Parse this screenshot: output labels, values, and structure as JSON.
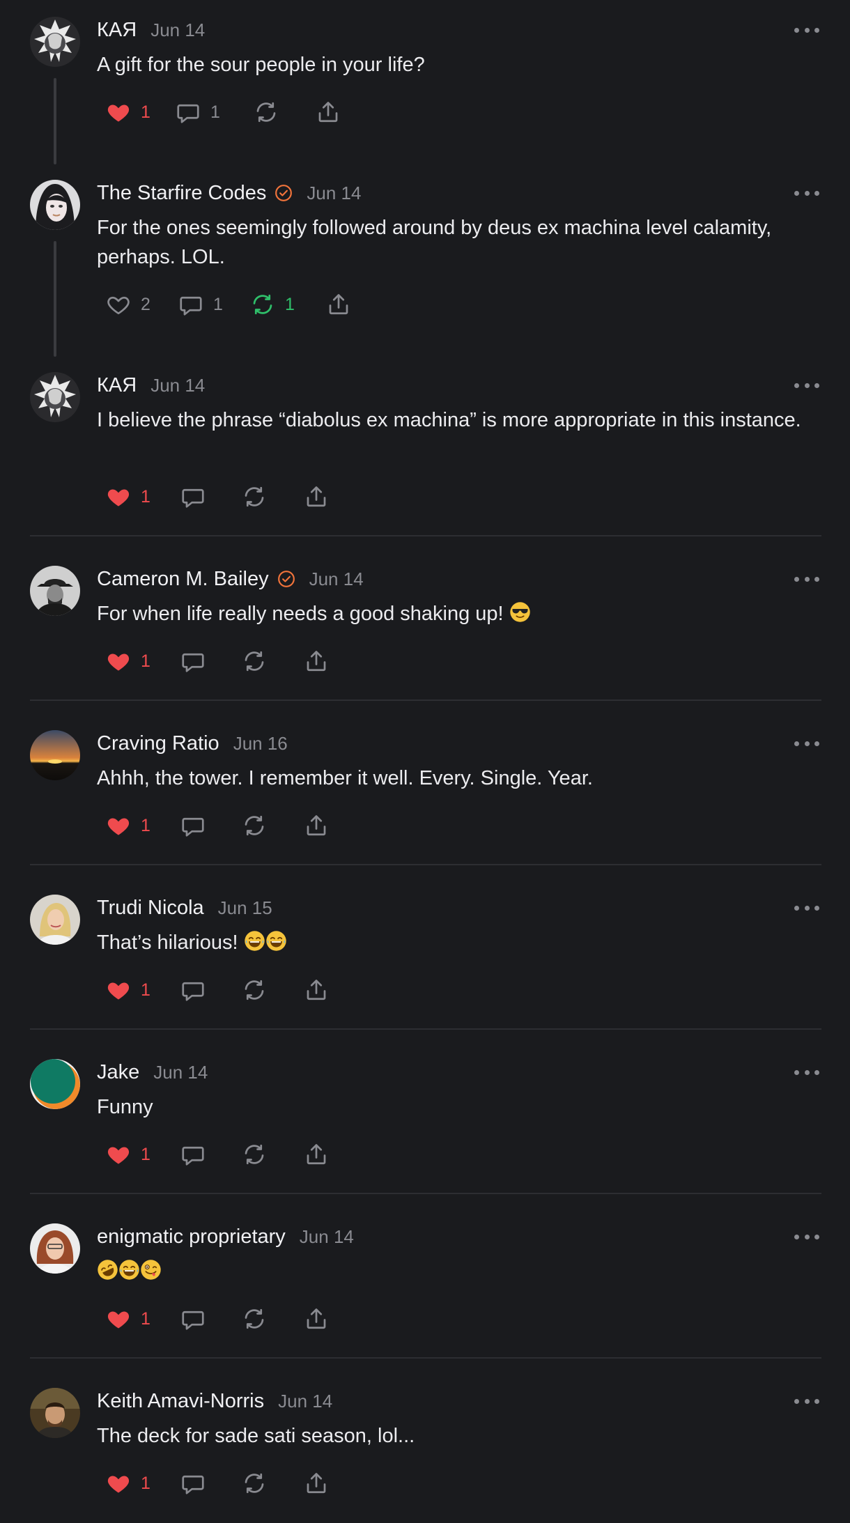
{
  "colors": {
    "background": "#1a1b1e",
    "like_active": "#ef4b4e",
    "repost_active": "#2fbf6a",
    "verified": "#f2743b",
    "muted": "#8a8b91"
  },
  "posts": [
    {
      "name": "КАЯ",
      "date": "Jun 14",
      "text": "A gift for the sour people in your life?",
      "likes": "1",
      "replies": "1",
      "reposts": ""
    },
    {
      "name": "The Starfire Codes",
      "date": "Jun 14",
      "text": "For the ones seemingly followed around by deus ex machina level calamity, perhaps. LOL.",
      "likes": "2",
      "replies": "1",
      "reposts": "1"
    },
    {
      "name": "КАЯ",
      "date": "Jun 14",
      "text": "I believe the phrase “diabolus ex machina” is more appropriate in this instance.",
      "likes": "1",
      "replies": "",
      "reposts": ""
    },
    {
      "name": "Cameron M. Bailey",
      "date": "Jun 14",
      "text": "For when life really needs a good shaking up!",
      "likes": "1",
      "replies": "",
      "reposts": ""
    },
    {
      "name": "Craving Ratio",
      "date": "Jun 16",
      "text": "Ahhh, the tower. I remember it well. Every. Single. Year.",
      "likes": "1",
      "replies": "",
      "reposts": ""
    },
    {
      "name": "Trudi Nicola",
      "date": "Jun 15",
      "text": "That’s hilarious!",
      "likes": "1",
      "replies": "",
      "reposts": ""
    },
    {
      "name": "Jake",
      "date": "Jun 14",
      "text": "Funny",
      "likes": "1",
      "replies": "",
      "reposts": ""
    },
    {
      "name": "enigmatic proprietary",
      "date": "Jun 14",
      "text": "",
      "likes": "1",
      "replies": "",
      "reposts": ""
    },
    {
      "name": "Keith Amavi-Norris",
      "date": "Jun 14",
      "text": "The deck for sade sati season, lol...",
      "likes": "1",
      "replies": "",
      "reposts": ""
    }
  ]
}
